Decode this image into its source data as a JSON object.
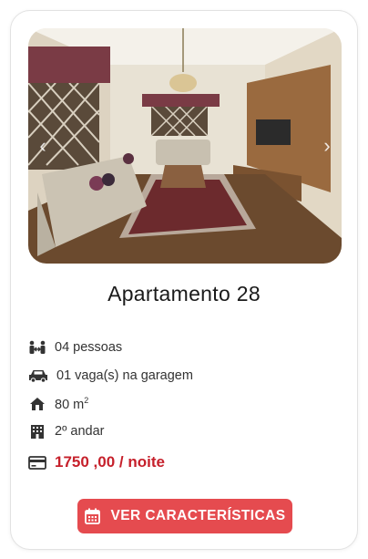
{
  "listing": {
    "title": "Apartamento 28",
    "features": [
      {
        "icon": "people-icon",
        "text": "04 pessoas"
      },
      {
        "icon": "car-icon",
        "text": "01 vaga(s) na garagem"
      },
      {
        "icon": "house-icon",
        "text": "80 m",
        "sup": "2"
      },
      {
        "icon": "building-icon",
        "text": "2º andar"
      }
    ],
    "price": "1750 ,00 / noite",
    "cta_label": "VER CARACTERÍSTICAS"
  },
  "carousel": {
    "prev_glyph": "‹",
    "next_glyph": "›"
  },
  "colors": {
    "accent": "#e54b4f",
    "price": "#c6202b"
  }
}
